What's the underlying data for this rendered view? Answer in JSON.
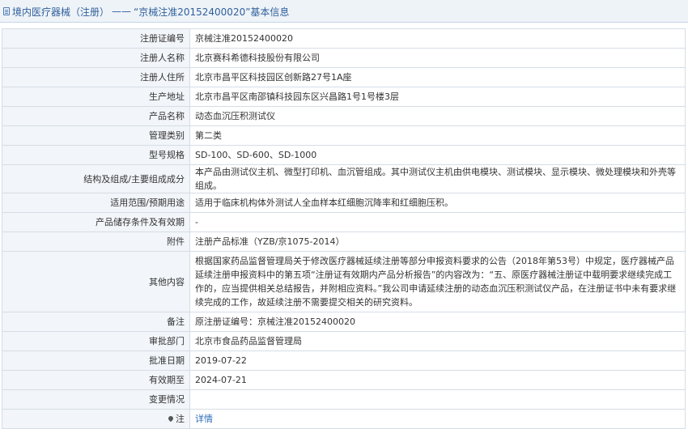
{
  "header": {
    "category": "境内医疗器械（注册）",
    "dash": "——",
    "title": "“京械注准20152400020”基本信息"
  },
  "rows": [
    {
      "label": "注册证编号",
      "value": "京械注准20152400020"
    },
    {
      "label": "注册人名称",
      "value": "北京赛科希德科技股份有限公司"
    },
    {
      "label": "注册人住所",
      "value": "北京市昌平区科技园区创新路27号1A座"
    },
    {
      "label": "生产地址",
      "value": "北京市昌平区南邵镇科技园东区兴昌路1号1号楼3层"
    },
    {
      "label": "产品名称",
      "value": "动态血沉压积测试仪"
    },
    {
      "label": "管理类别",
      "value": "第二类"
    },
    {
      "label": "型号规格",
      "value": "SD-100、SD-600、SD-1000"
    },
    {
      "label": "结构及组成/主要组成成分",
      "value": "本产品由测试仪主机、微型打印机、血沉管组成。其中测试仪主机由供电模块、测试模块、显示模块、微处理模块和外壳等组成。"
    },
    {
      "label": "适用范围/预期用途",
      "value": "适用于临床机构体外测试人全血样本红细胞沉降率和红细胞压积。"
    },
    {
      "label": "产品储存条件及有效期",
      "value": "-"
    },
    {
      "label": "附件",
      "value": "注册产品标准（YZB/京1075-2014）"
    },
    {
      "label": "其他内容",
      "value": "根据国家药品监督管理局关于修改医疗器械延续注册等部分申报资料要求的公告（2018年第53号）中规定，医疗器械产品延续注册申报资料中的第五项“注册证有效期内产品分析报告”的内容改为：“五、原医疗器械注册证中载明要求继续完成工作的，应当提供相关总结报告，并附相应资料。”我公司申请延续注册的动态血沉压积测试仪产品，在注册证书中未有要求继续完成的工作，故延续注册不需要提交相关的研究资料。"
    },
    {
      "label": "备注",
      "value": "原注册证编号：京械注准20152400020"
    },
    {
      "label": "审批部门",
      "value": "北京市食品药品监督管理局"
    },
    {
      "label": "批准日期",
      "value": "2019-07-22"
    },
    {
      "label": "有效期至",
      "value": "2024-07-21"
    },
    {
      "label": "变更情况",
      "value": ""
    }
  ],
  "note_row": {
    "label": "注",
    "link": "详情"
  },
  "colors": {
    "accent": "#2f5f9a",
    "label_bg": "#f2f5f9",
    "border": "#d6dde6",
    "link": "#2a6bb8"
  }
}
